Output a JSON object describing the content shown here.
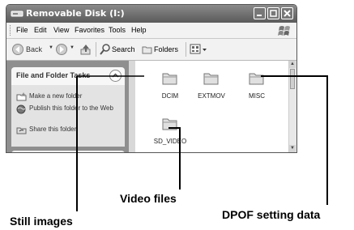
{
  "window": {
    "title": "Removable Disk (I:)",
    "buttons": [
      "minimize",
      "maximize",
      "close"
    ]
  },
  "menu": [
    "File",
    "Edit",
    "View",
    "Favorites",
    "Tools",
    "Help"
  ],
  "toolbar": {
    "back": "Back",
    "search": "Search",
    "folders": "Folders"
  },
  "tasks_panel": {
    "title": "File and Folder Tasks",
    "items": [
      "Make a new folder",
      "Publish this folder to the Web",
      "Share this folder"
    ]
  },
  "folders": [
    "DCIM",
    "EXTMOV",
    "MISC",
    "SD_VIDEO"
  ],
  "callouts": {
    "still": "Still images",
    "video": "Video files",
    "dpof": "DPOF setting data"
  },
  "icons": [
    "drive-icon",
    "windows-logo-icon",
    "back-arrow-icon",
    "forward-arrow-icon",
    "up-folder-icon",
    "search-icon",
    "folders-icon",
    "views-icon",
    "new-folder-icon",
    "globe-icon",
    "share-icon",
    "folder-icon"
  ]
}
